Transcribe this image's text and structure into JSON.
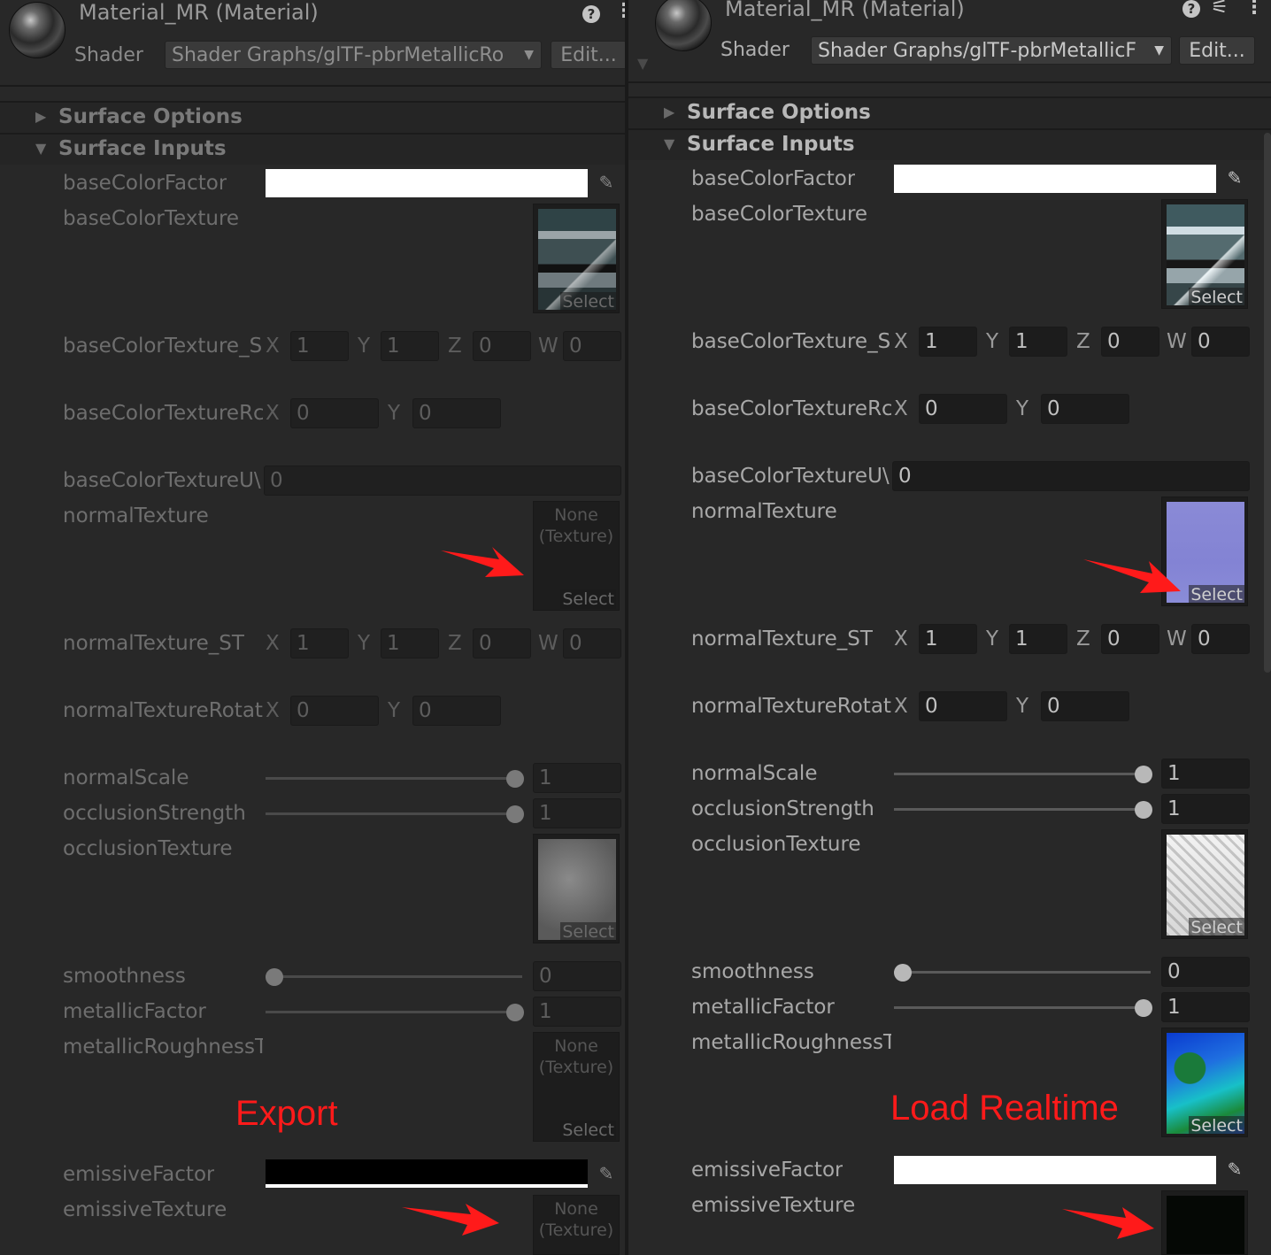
{
  "material_title": "Material_MR (Material)",
  "shader_label": "Shader",
  "shader_value_left": "Shader Graphs/glTF-pbrMetallicRo",
  "shader_value_right": "Shader Graphs/glTF-pbrMetallicF",
  "edit_label": "Edit...",
  "sections": {
    "surface_options": "Surface Options",
    "surface_inputs": "Surface Inputs"
  },
  "props": {
    "baseColorFactor": "baseColorFactor",
    "baseColorTexture": "baseColorTexture",
    "baseColorTexture_ST": "baseColorTexture_S",
    "baseColorTextureRotation": "baseColorTextureRc",
    "baseColorTextureUV": "baseColorTextureU\\",
    "normalTexture": "normalTexture",
    "normalTexture_ST": "normalTexture_ST",
    "normalTextureRotation": "normalTextureRotat",
    "normalScale": "normalScale",
    "occlusionStrength": "occlusionStrength",
    "occlusionTexture": "occlusionTexture",
    "smoothness": "smoothness",
    "metallicFactor": "metallicFactor",
    "metallicRoughnessTexture": "metallicRoughnessT",
    "emissiveFactor": "emissiveFactor",
    "emissiveTexture": "emissiveTexture"
  },
  "axes": {
    "x": "X",
    "y": "Y",
    "z": "Z",
    "w": "W"
  },
  "values": {
    "st_x": "1",
    "st_y": "1",
    "st_z": "0",
    "st_w": "0",
    "rot_x": "0",
    "rot_y": "0",
    "uv": "0",
    "normalScale": "1",
    "occlusionStrength": "1",
    "smoothness": "0",
    "metallicFactor": "1"
  },
  "slider_levels": {
    "normalScale": 1,
    "occlusionStrength": 1,
    "smoothness": 0,
    "metallicFactor": 1
  },
  "texture_slot": {
    "none_line1": "None",
    "none_line2": "(Texture)",
    "select": "Select"
  },
  "colors": {
    "left": {
      "baseColorFactor": "#ffffff",
      "emissiveFactor": "#000000"
    },
    "right": {
      "baseColorFactor": "#ffffff",
      "emissiveFactor": "#ffffff"
    },
    "annotation": "#ff1a1a"
  },
  "annotations": {
    "left": "Export",
    "right": "Load Realtime"
  },
  "icons": {
    "help": "help-icon",
    "menu": "kebab-menu-icon",
    "preset": "preset-sliders-icon",
    "picker": "eyedropper-icon",
    "collapse": "triangle-icon"
  }
}
